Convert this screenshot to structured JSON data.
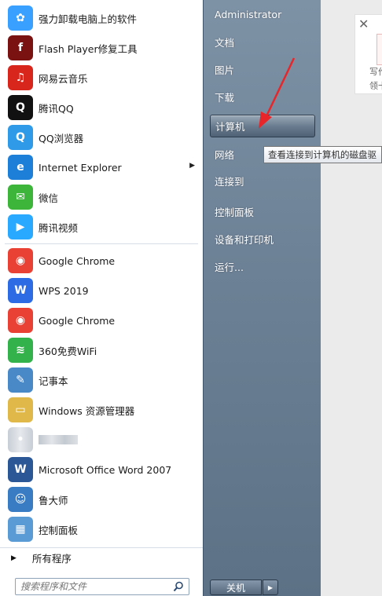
{
  "programs": [
    {
      "label": "强力卸载电脑上的软件",
      "icon": "colorful-flower-icon",
      "color": "#3aa0ff"
    },
    {
      "label": "Flash Player修复工具",
      "icon": "flash-player-icon",
      "color": "#7a1212"
    },
    {
      "label": "网易云音乐",
      "icon": "netease-music-icon",
      "color": "#d9261c"
    },
    {
      "label": "腾讯QQ",
      "icon": "qq-penguin-icon",
      "color": "#111111"
    },
    {
      "label": "QQ浏览器",
      "icon": "qq-browser-icon",
      "color": "#2f9be8"
    },
    {
      "label": "Internet Explorer",
      "icon": "internet-explorer-icon",
      "color": "#1e7fd8",
      "has_submenu": true
    },
    {
      "label": "微信",
      "icon": "wechat-icon",
      "color": "#3db43a"
    },
    {
      "label": "腾讯视频",
      "icon": "tencent-video-icon",
      "color": "#29a9ff"
    }
  ],
  "recent_programs": [
    {
      "label": "Google Chrome",
      "icon": "chrome-icon",
      "color": "#e94235"
    },
    {
      "label": "WPS 2019",
      "icon": "wps-icon",
      "color": "#2d6be4"
    },
    {
      "label": "Google Chrome",
      "icon": "chrome-icon",
      "color": "#e94235"
    },
    {
      "label": "360免费WiFi",
      "icon": "wifi-icon",
      "color": "#33b14a"
    },
    {
      "label": "记事本",
      "icon": "notepad-icon",
      "color": "#4a89c8"
    },
    {
      "label": "Windows 资源管理器",
      "icon": "folder-explorer-icon",
      "color": "#e0b84a"
    },
    {
      "label": "",
      "icon": "blurred-app-icon",
      "color": "#9aa6b4"
    },
    {
      "label": "Microsoft Office Word 2007",
      "icon": "word-icon",
      "color": "#2b5797"
    },
    {
      "label": "鲁大师",
      "icon": "ludashi-icon",
      "color": "#3a7cc4"
    },
    {
      "label": "控制面板",
      "icon": "control-panel-icon",
      "color": "#5b9bd5"
    }
  ],
  "all_programs_label": "所有程序",
  "search_placeholder": "搜索程序和文件",
  "right_menu": [
    {
      "label": "Administrator"
    },
    {
      "label": "文档"
    },
    {
      "label": "图片"
    },
    {
      "label": "下载"
    },
    {
      "label": "计算机",
      "active": true
    },
    {
      "label": "网络"
    },
    {
      "label": "连接到"
    },
    {
      "label": "控制面板"
    },
    {
      "label": "设备和打印机"
    },
    {
      "label": "运行..."
    }
  ],
  "shutdown_label": "关机",
  "tooltip_text": "查看连接到计算机的磁盘驱",
  "notice": {
    "line1": "写作",
    "line2": "领卡"
  },
  "colors": {
    "arrow": "#e8262a",
    "panel": "#6d8196"
  }
}
